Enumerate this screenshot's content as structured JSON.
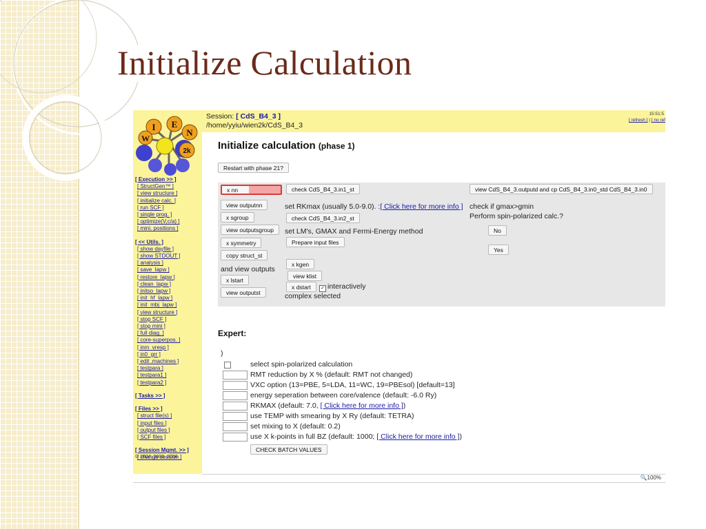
{
  "slide": {
    "title": "Initialize Calculation"
  },
  "logo": {
    "letters": [
      "I",
      "E",
      "W",
      "N"
    ],
    "badge": "2k"
  },
  "header": {
    "session_prefix": "Session: ",
    "session_name": "[ CdS_B4_3 ]",
    "path": "/home/yyiu/wien2k/CdS_B4_3",
    "clock": "15:51:5",
    "refresh": "[ refresh ]",
    "sep": " | ",
    "no_refresh": "[ no ref"
  },
  "sidebar": {
    "execution": "[ Execution >> ]",
    "execution_items": [
      "[ StructGen™ ]",
      "[ view structure ]",
      "[ initialize calc. ]",
      "[ run SCF ]",
      "[ single prog. ]",
      "[ optimize(V,c/a) ]",
      "[ mini. positions ]"
    ],
    "utils": "[ << Utils. ]",
    "utils_items": [
      "[ show dayfile ]",
      "[ show STDOUT ]",
      "[ analysis ]",
      "[ save_lapw ]",
      "[ restore_lapw ]",
      "[ clean_lapw ]",
      "[ initso_lapw ]",
      "[ init_hf_lapw ]",
      "[ init_mbj_lapw ]",
      "[ view structure ]",
      "[ stop SCF ]",
      "[ stop mini ]",
      "[ full diag. ]",
      "[ core-superpos. ]",
      "[ inm_vresp ]",
      "[ in0_grr ]",
      "[ edit .machines ]",
      "[ testpara ]",
      "[ testpara1 ]",
      "[ testpara2 ]"
    ],
    "tasks": "[ Tasks >> ]",
    "files": "[ Files >> ]",
    "files_items": [
      "[ struct file(s) ]",
      "[ input files ]",
      "[ output files ]",
      "[ SCF files ]"
    ],
    "session_mgmt": "[ Session Mgmt. >> ]",
    "change_session": "[ change session ]",
    "overlay_text": "© 2004, 2006, 2006"
  },
  "main": {
    "title": "Initialize calculation",
    "phase": "(phase 1)",
    "restart_btn": "Restart with phase 21?",
    "btn_xnn": "x nn",
    "btn_check_in1": "check CdS_B4_3.in1_st",
    "btn_view_outputd": "view CdS_B4_3.outputd and cp CdS_B4_3.in0_std CdS_B4_3.in0",
    "btn_view_outputnn": "view outputnn",
    "set_rkmax": "set RKmax (usually 5.0-9.0). :",
    "more_info_link": "[ Click here for more info ]",
    "check_gmax": "check if gmax>gmin",
    "btn_xsgroup": "x sgroup",
    "btn_check_in2": "check CdS_B4_3.in2_st",
    "perform_spin": "Perform spin-polarized calc.?",
    "btn_view_outputsgroup": "view outputsgroup",
    "set_lm": "set LM's, GMAX and Fermi-Energy method",
    "btn_no": "No",
    "btn_xsymmetry": "x symmetry",
    "btn_prepare": "Prepare input files",
    "btn_copy_struct": "copy struct_st",
    "btn_yes": "Yes",
    "btn_xkgen": "x kgen",
    "and_view_outputs": "and view outputs",
    "btn_view_klist": "view klist",
    "btn_xlstart": "x lstart",
    "btn_xdstart": "x dstart",
    "interactively": "interactively",
    "btn_view_outputst": "view outputst",
    "complex_selected": "complex selected"
  },
  "expert": {
    "title": "Expert:",
    "paren": ")",
    "spin_label": "select spin-polarized calculation",
    "rows": [
      "RMT reduction by X % (default: RMT not changed)",
      "VXC option (13=PBE, 5=LDA, 11=WC, 19=PBEsol) [default=13]",
      "energy seperation between core/valence (default: -6.0 Ry)",
      "RKMAX (default: 7.0, ",
      "use TEMP with smearing by X Ry (default: TETRA)",
      "set mixing to X (default: 0.2)",
      "use X k-points in full BZ (default: 1000; "
    ],
    "rkmax_tail": ")",
    "kpoints_tail": ")",
    "check_btn": "CHECK BATCH VALUES"
  },
  "status": {
    "zoom": "100%"
  }
}
